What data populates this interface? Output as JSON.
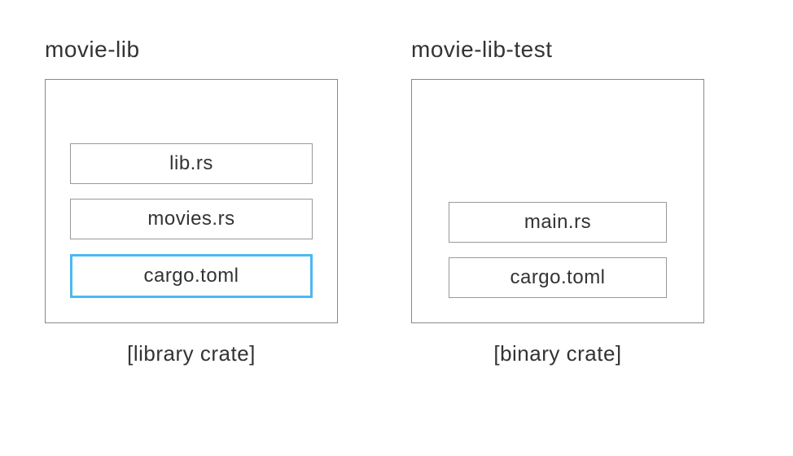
{
  "left": {
    "title": "movie-lib",
    "files": [
      {
        "name": "lib.rs",
        "highlighted": false
      },
      {
        "name": "movies.rs",
        "highlighted": false
      },
      {
        "name": "cargo.toml",
        "highlighted": true
      }
    ],
    "caption": "[library crate]"
  },
  "right": {
    "title": "movie-lib-test",
    "files": [
      {
        "name": "main.rs",
        "highlighted": false
      },
      {
        "name": "cargo.toml",
        "highlighted": false
      }
    ],
    "caption": "[binary crate]"
  }
}
